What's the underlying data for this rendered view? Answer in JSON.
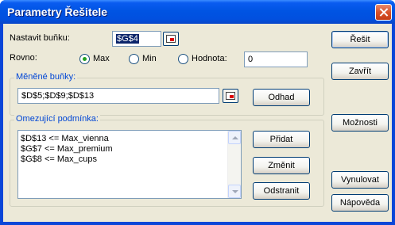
{
  "window": {
    "title": "Parametry Řešitele"
  },
  "target_cell": {
    "label": "Nastavit buňku:",
    "value": "$G$4"
  },
  "equal_to": {
    "label": "Rovno:",
    "options": [
      {
        "label": "Max",
        "selected": true
      },
      {
        "label": "Min",
        "selected": false
      },
      {
        "label": "Hodnota:",
        "selected": false
      }
    ],
    "value": "0"
  },
  "changing_cells": {
    "group_title": "Měněné buňky:",
    "value": "$D$5;$D$9;$D$13",
    "guess_label": "Odhad"
  },
  "constraints": {
    "group_title": "Omezující podmínka:",
    "items": [
      "$D$13 <= Max_vienna",
      "$G$7 <= Max_premium",
      "$G$8 <= Max_cups"
    ],
    "add_label": "Přidat",
    "change_label": "Změnit",
    "delete_label": "Odstranit"
  },
  "side_buttons": {
    "solve": "Řešit",
    "close": "Zavřít",
    "options": "Možnosti",
    "reset": "Vynulovat",
    "help": "Nápověda"
  }
}
